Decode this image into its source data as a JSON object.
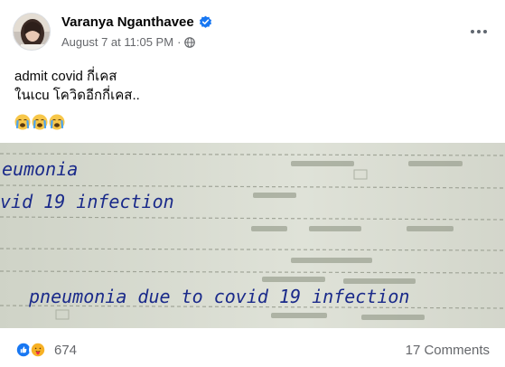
{
  "post": {
    "author": "Varanya Nganthavee",
    "verified_icon": "verified-badge-icon",
    "timestamp": "August 7 at 11:05 PM",
    "separator": "·",
    "audience_icon": "globe-icon",
    "more_icon": "more-options-icon",
    "text_lines": [
      "admit covid กี่เคส",
      "ในเcu โควิดอีกกี่เคส.."
    ],
    "emojis": [
      "crying-face-emoji",
      "crying-face-emoji",
      "crying-face-emoji"
    ],
    "photo": {
      "handwriting": [
        "eumonia",
        "vid 19 infection",
        "pneumonia  due to covid  19 infection"
      ]
    },
    "reactions": {
      "icons": [
        "like-reaction-icon",
        "care-reaction-icon"
      ],
      "count": "674"
    },
    "comments": "17 Comments"
  },
  "colors": {
    "accent": "#1877f2",
    "secondary_text": "#65676b",
    "ink": "#1a2a8a"
  }
}
